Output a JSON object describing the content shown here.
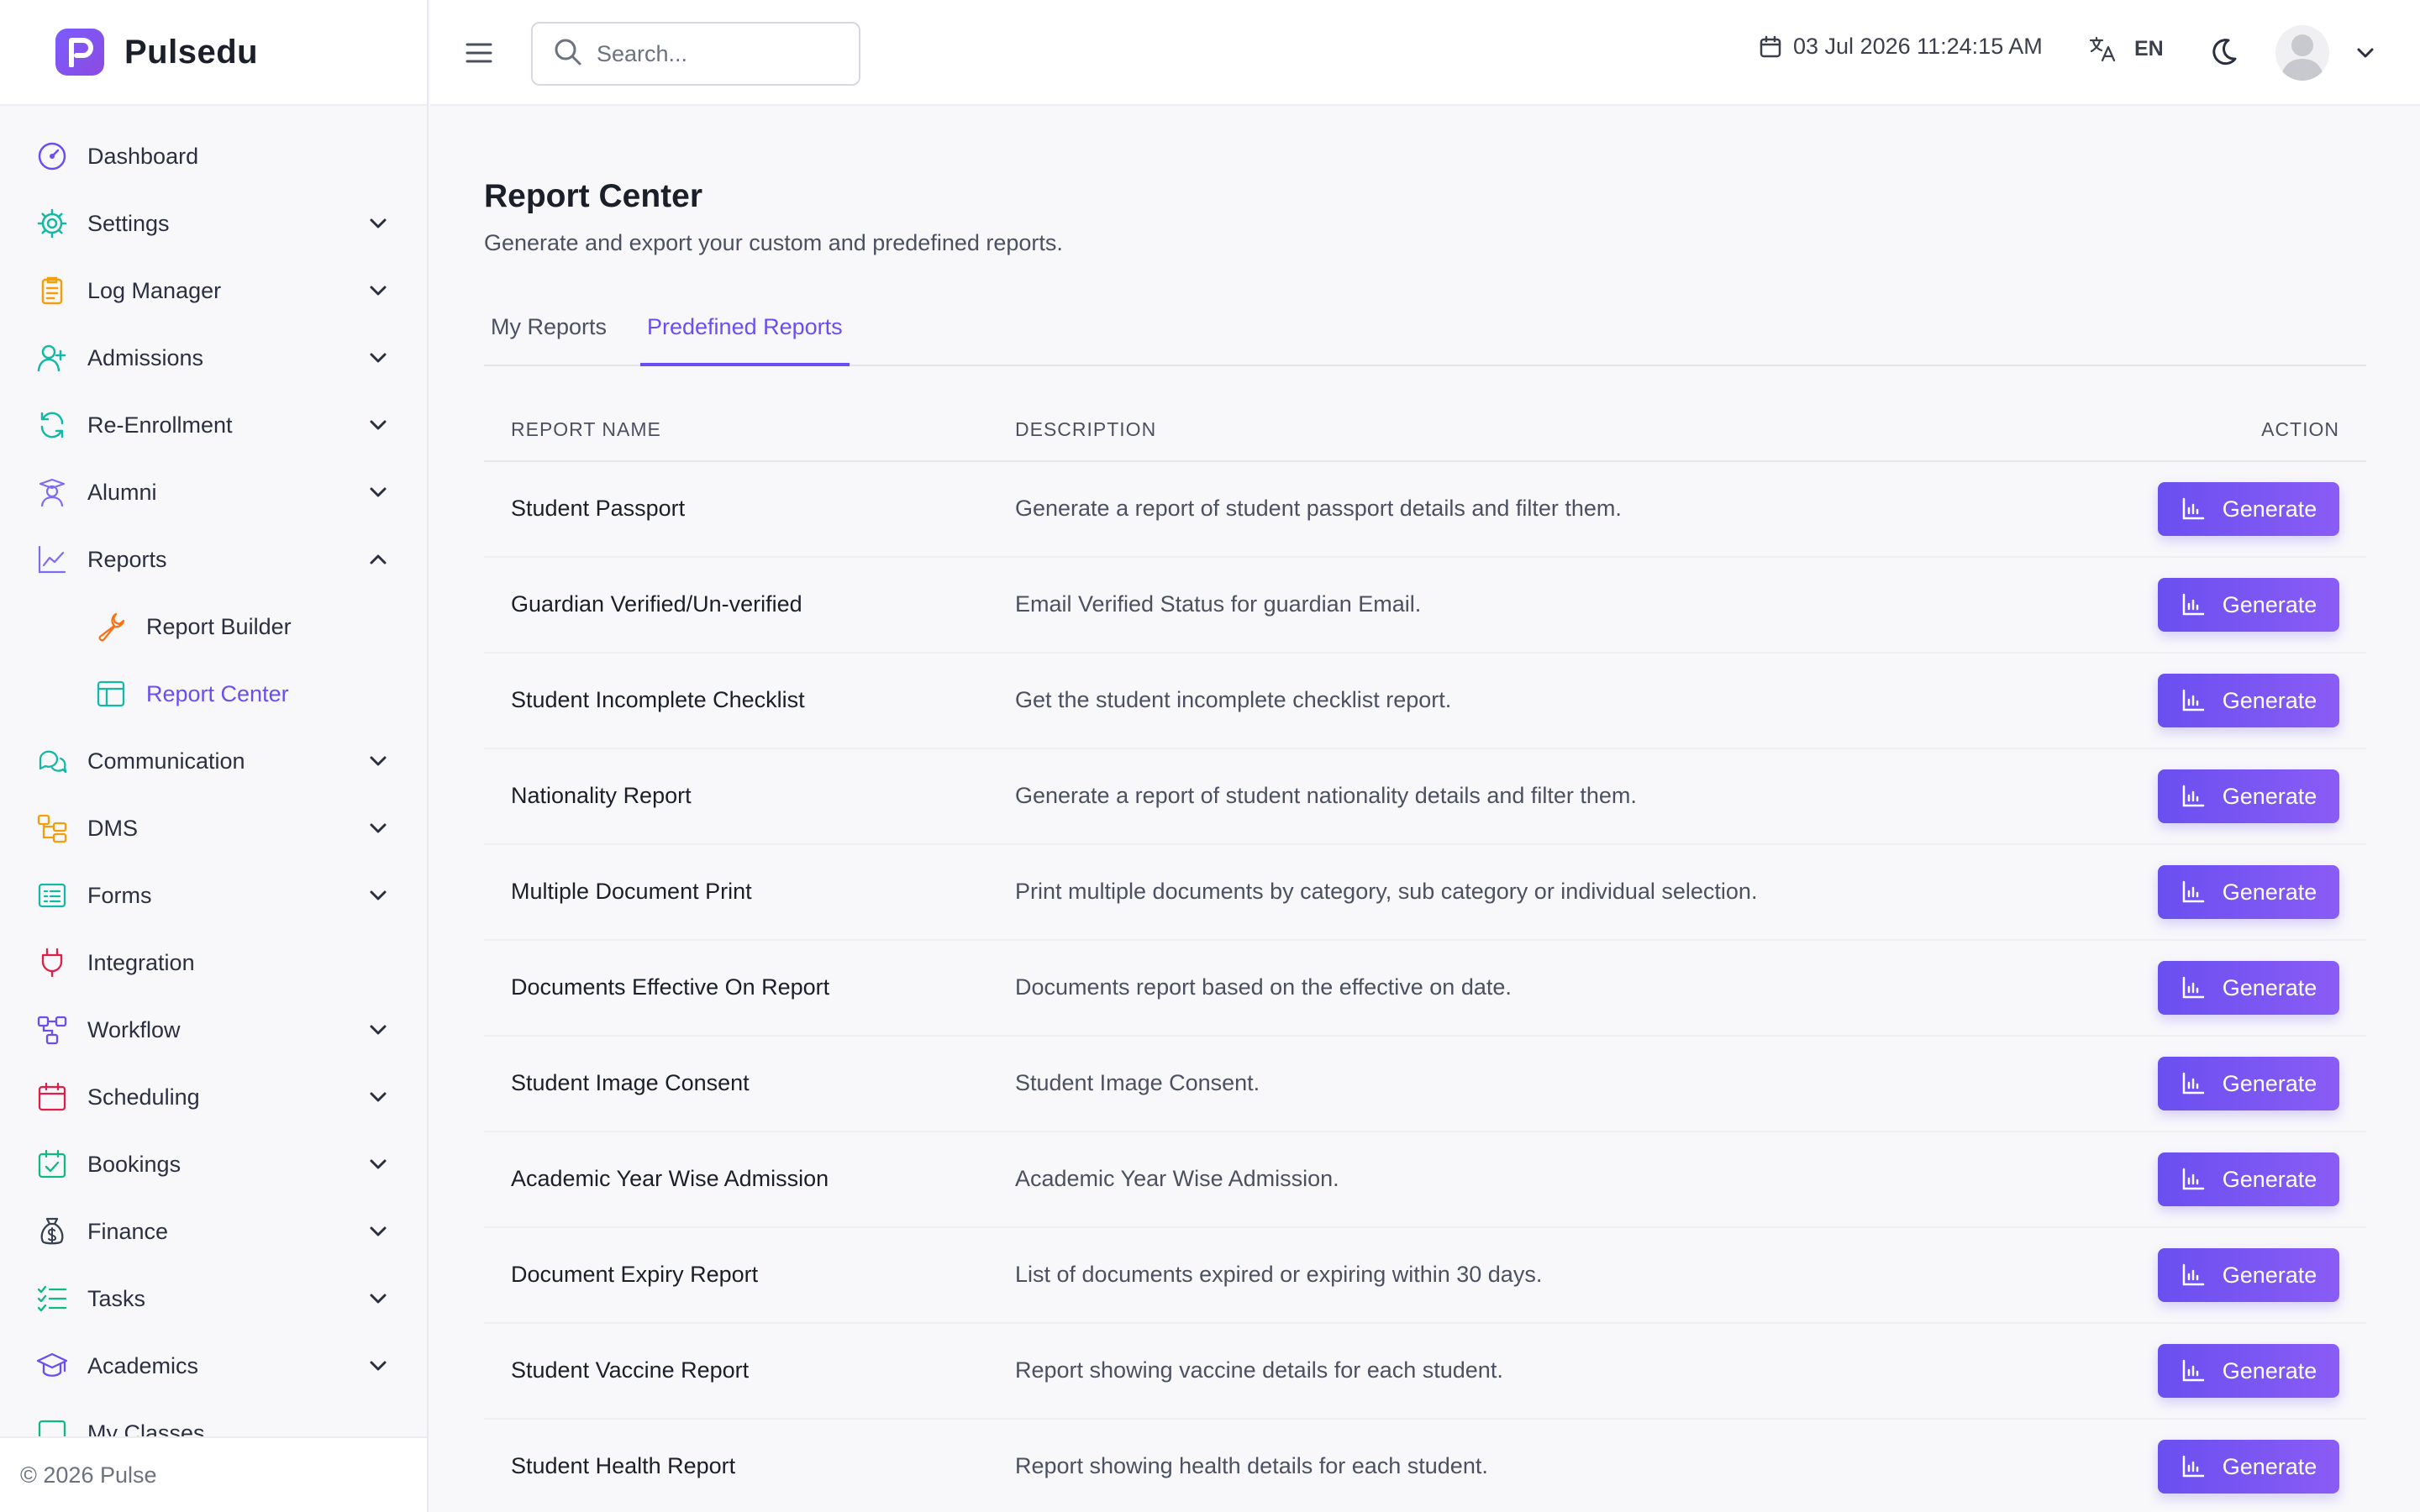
{
  "brand": {
    "name": "Pulsedu"
  },
  "sidebar": {
    "items": [
      {
        "label": "Dashboard",
        "icon": "dashboard-icon",
        "color": "#6a4ff0",
        "chevron": ""
      },
      {
        "label": "Settings",
        "icon": "gear-icon",
        "color": "#14b8a6",
        "chevron": "down"
      },
      {
        "label": "Log Manager",
        "icon": "clipboard-icon",
        "color": "#f59e0b",
        "chevron": "down"
      },
      {
        "label": "Admissions",
        "icon": "user-plus-icon",
        "color": "#14b8a6",
        "chevron": "down"
      },
      {
        "label": "Re-Enrollment",
        "icon": "refresh-icon",
        "color": "#14b8a6",
        "chevron": "down"
      },
      {
        "label": "Alumni",
        "icon": "graduate-icon",
        "color": "#7c6cf0",
        "chevron": "down"
      },
      {
        "label": "Reports",
        "icon": "line-chart-icon",
        "color": "#7c6cf0",
        "chevron": "up"
      },
      {
        "label": "Report Builder",
        "icon": "wrench-icon",
        "color": "#f97316",
        "chevron": "",
        "sub": true
      },
      {
        "label": "Report Center",
        "icon": "table-icon",
        "color": "#14b8a6",
        "chevron": "",
        "sub": true,
        "active": true
      },
      {
        "label": "Communication",
        "icon": "chat-icon",
        "color": "#14b8a6",
        "chevron": "down"
      },
      {
        "label": "DMS",
        "icon": "folder-tree-icon",
        "color": "#f59e0b",
        "chevron": "down"
      },
      {
        "label": "Forms",
        "icon": "form-icon",
        "color": "#14b8a6",
        "chevron": "down"
      },
      {
        "label": "Integration",
        "icon": "plug-icon",
        "color": "#e11d48",
        "chevron": ""
      },
      {
        "label": "Workflow",
        "icon": "workflow-icon",
        "color": "#6a4ff0",
        "chevron": "down"
      },
      {
        "label": "Scheduling",
        "icon": "calendar-icon",
        "color": "#e11d48",
        "chevron": "down"
      },
      {
        "label": "Bookings",
        "icon": "calendar-check-icon",
        "color": "#10b981",
        "chevron": "down"
      },
      {
        "label": "Finance",
        "icon": "money-bag-icon",
        "color": "#374151",
        "chevron": "down"
      },
      {
        "label": "Tasks",
        "icon": "checklist-icon",
        "color": "#10b981",
        "chevron": "down"
      },
      {
        "label": "Academics",
        "icon": "graduation-cap-icon",
        "color": "#6a4ff0",
        "chevron": "down"
      },
      {
        "label": "My Classes",
        "icon": "classes-icon",
        "color": "#10b981",
        "chevron": ""
      }
    ],
    "footer": "© 2026 Pulse"
  },
  "topbar": {
    "search_placeholder": "Search...",
    "datetime": "03 Jul 2026 11:24:15 AM",
    "language": "EN"
  },
  "page": {
    "title": "Report Center",
    "subtitle": "Generate and export your custom and predefined reports.",
    "tabs": [
      {
        "label": "My Reports",
        "active": false
      },
      {
        "label": "Predefined Reports",
        "active": true
      }
    ]
  },
  "table": {
    "headers": {
      "name": "REPORT NAME",
      "description": "DESCRIPTION",
      "action": "ACTION"
    },
    "action_label": "Generate",
    "rows": [
      {
        "name": "Student Passport",
        "description": "Generate a report of student passport details and filter them."
      },
      {
        "name": "Guardian Verified/Un-verified",
        "description": "Email Verified Status for guardian Email."
      },
      {
        "name": "Student Incomplete Checklist",
        "description": "Get the student incomplete checklist report."
      },
      {
        "name": "Nationality Report",
        "description": "Generate a report of student nationality details and filter them."
      },
      {
        "name": "Multiple Document Print",
        "description": "Print multiple documents by category, sub category or individual selection."
      },
      {
        "name": "Documents Effective On Report",
        "description": "Documents report based on the effective on date."
      },
      {
        "name": "Student Image Consent",
        "description": "Student Image Consent."
      },
      {
        "name": "Academic Year Wise Admission",
        "description": "Academic Year Wise Admission."
      },
      {
        "name": "Document Expiry Report",
        "description": "List of documents expired or expiring within 30 days."
      },
      {
        "name": "Student Vaccine Report",
        "description": "Report showing vaccine details for each student."
      },
      {
        "name": "Student Health Report",
        "description": "Report showing health details for each student."
      }
    ]
  },
  "colors": {
    "accent": "#6a4ff0",
    "accent_end": "#8a5cf5"
  }
}
